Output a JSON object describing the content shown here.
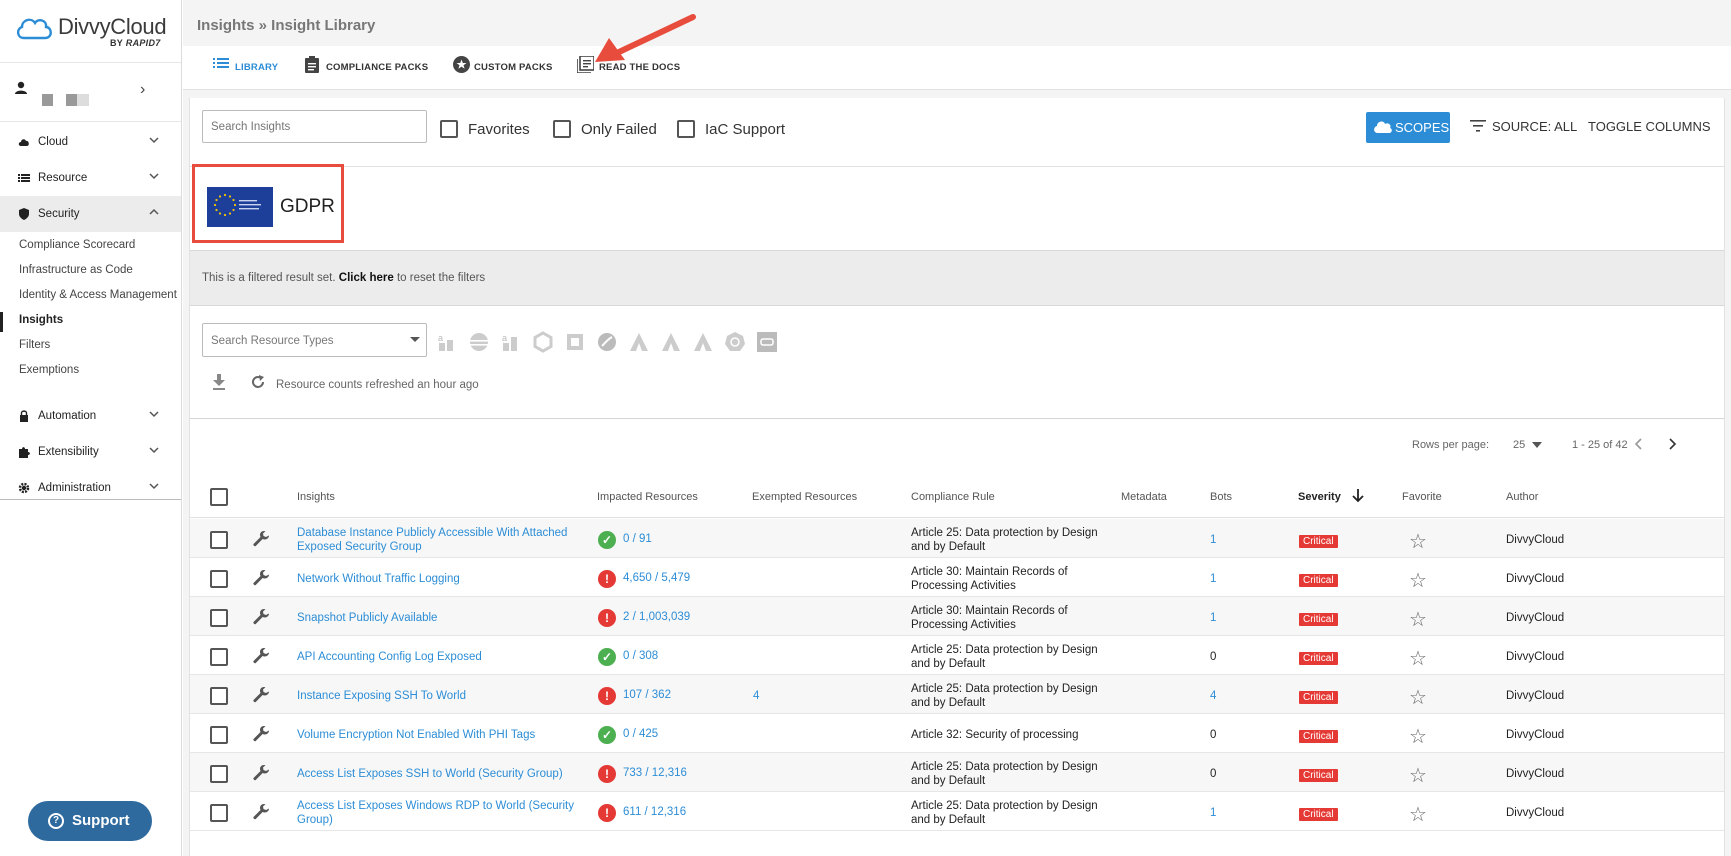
{
  "app": {
    "brand": "DivvyCloud",
    "brand_by": "BY",
    "brand_by_company": "RAPID7"
  },
  "sidebar": {
    "items": [
      {
        "label": "Cloud",
        "icon": "cloud-icon"
      },
      {
        "label": "Resource",
        "icon": "list-icon"
      },
      {
        "label": "Security",
        "icon": "shield-icon"
      },
      {
        "label": "Automation",
        "icon": "lock-icon"
      },
      {
        "label": "Extensibility",
        "icon": "puzzle-icon"
      },
      {
        "label": "Administration",
        "icon": "gear-icon"
      }
    ],
    "security_sub": [
      "Compliance Scorecard",
      "Infrastructure as Code",
      "Identity & Access Management",
      "Insights",
      "Filters",
      "Exemptions"
    ],
    "support_label": "Support"
  },
  "header": {
    "breadcrumb": "Insights » Insight Library"
  },
  "tabs": [
    {
      "label": "LIBRARY",
      "icon": "list-icon"
    },
    {
      "label": "COMPLIANCE PACKS",
      "icon": "clipboard-icon"
    },
    {
      "label": "CUSTOM PACKS",
      "icon": "star-circle-icon"
    },
    {
      "label": "READ THE DOCS",
      "icon": "docs-icon"
    }
  ],
  "toolbar": {
    "search_placeholder": "Search Insights",
    "favorites_label": "Favorites",
    "only_failed_label": "Only Failed",
    "iac_label": "IaC Support",
    "scopes_label": "SCOPES",
    "source_label": "SOURCE: ALL",
    "toggle_columns_label": "TOGGLE COLUMNS"
  },
  "pack": {
    "title": "GDPR",
    "flag_text": "General Data Protection Regulation"
  },
  "filter_notice": {
    "prefix": "This is a filtered result set.",
    "link": "Click here",
    "suffix": "to reset the filters"
  },
  "resources": {
    "search_placeholder": "Search Resource Types",
    "refresh_text": "Resource counts refreshed an hour ago"
  },
  "pagination": {
    "rows_label": "Rows per page:",
    "rows_value": "25",
    "range": "1 - 25 of 42"
  },
  "table": {
    "headers": {
      "insights": "Insights",
      "impacted": "Impacted Resources",
      "exempted": "Exempted Resources",
      "rule": "Compliance Rule",
      "metadata": "Metadata",
      "bots": "Bots",
      "severity": "Severity",
      "favorite": "Favorite",
      "author": "Author"
    },
    "rows": [
      {
        "name": "Database Instance Publicly Accessible With Attached Exposed Security Group",
        "status": "ok",
        "impacted": "0 / 91",
        "exempted": "",
        "rule": "Article 25: Data protection by Design and by Default",
        "bots": "1",
        "severity": "Critical",
        "author": "DivvyCloud"
      },
      {
        "name": "Network Without Traffic Logging",
        "status": "fail",
        "impacted": "4,650 / 5,479",
        "exempted": "",
        "rule": "Article 30: Maintain Records of Processing Activities",
        "bots": "1",
        "severity": "Critical",
        "author": "DivvyCloud"
      },
      {
        "name": "Snapshot Publicly Available",
        "status": "fail",
        "impacted": "2 / 1,003,039",
        "exempted": "",
        "rule": "Article 30: Maintain Records of Processing Activities",
        "bots": "1",
        "severity": "Critical",
        "author": "DivvyCloud"
      },
      {
        "name": "API Accounting Config Log Exposed",
        "status": "ok",
        "impacted": "0 / 308",
        "exempted": "",
        "rule": "Article 25: Data protection by Design and by Default",
        "bots": "0",
        "severity": "Critical",
        "author": "DivvyCloud"
      },
      {
        "name": "Instance Exposing SSH To World",
        "status": "fail",
        "impacted": "107 / 362",
        "exempted": "4",
        "rule": "Article 25: Data protection by Design and by Default",
        "bots": "4",
        "severity": "Critical",
        "author": "DivvyCloud"
      },
      {
        "name": "Volume Encryption Not Enabled With PHI Tags",
        "status": "ok",
        "impacted": "0 / 425",
        "exempted": "",
        "rule": "Article 32: Security of processing",
        "bots": "0",
        "severity": "Critical",
        "author": "DivvyCloud"
      },
      {
        "name": "Access List Exposes SSH to World (Security Group)",
        "status": "fail",
        "impacted": "733 / 12,316",
        "exempted": "",
        "rule": "Article 25: Data protection by Design and by Default",
        "bots": "0",
        "severity": "Critical",
        "author": "DivvyCloud"
      },
      {
        "name": "Access List Exposes Windows RDP to World (Security Group)",
        "status": "fail",
        "impacted": "611 / 12,316",
        "exempted": "",
        "rule": "Article 25: Data protection by Design and by Default",
        "bots": "1",
        "severity": "Critical",
        "author": "DivvyCloud"
      }
    ]
  },
  "colors": {
    "accent": "#2c8dd6",
    "critical": "#e53935",
    "ok": "#4caf50",
    "annotation": "#e74c3c",
    "support": "#2f6a9f"
  }
}
